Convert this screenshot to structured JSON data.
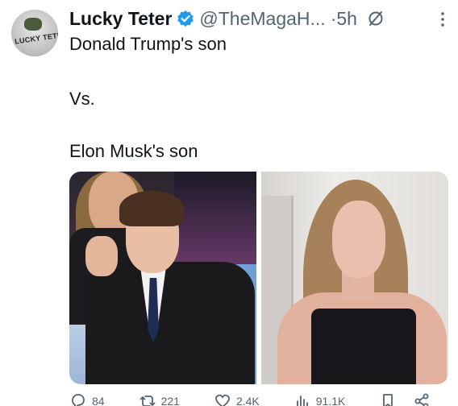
{
  "tweet": {
    "display_name": "Lucky Teter",
    "handle": "@TheMagaH...",
    "separator": "·",
    "time": "5h",
    "avatar_text": "LUCKY TETER",
    "text_line1": "Donald Trump's son",
    "text_line2": "Vs.",
    "text_line3": "Elon Musk's son"
  },
  "actions": {
    "reply_count": "84",
    "retweet_count": "221",
    "like_count": "2.4K",
    "views_count": "91.1K"
  },
  "icons": {
    "verified": "verified-badge-icon",
    "grok": "grok-icon",
    "more": "more-icon",
    "reply": "reply-icon",
    "retweet": "retweet-icon",
    "like": "like-icon",
    "views": "views-icon",
    "bookmark": "bookmark-icon",
    "share": "share-icon"
  },
  "colors": {
    "verified_blue": "#1d9bf0",
    "muted_text": "#536471",
    "primary_text": "#0f1419"
  }
}
